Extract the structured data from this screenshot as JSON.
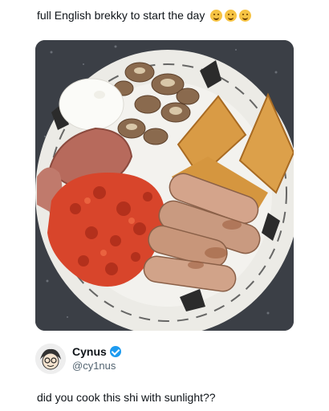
{
  "post": {
    "caption": "full English brekky to start the day",
    "emoji_count": 3,
    "emoji_icon": "smiling-face-icon"
  },
  "reply": {
    "display_name": "Cynus",
    "handle": "@cy1nus",
    "verified": true,
    "text": "did you cook this shi with sunlight??"
  },
  "colors": {
    "verified": "#1d9bf0",
    "handle": "#536471",
    "text": "#0f1419"
  }
}
